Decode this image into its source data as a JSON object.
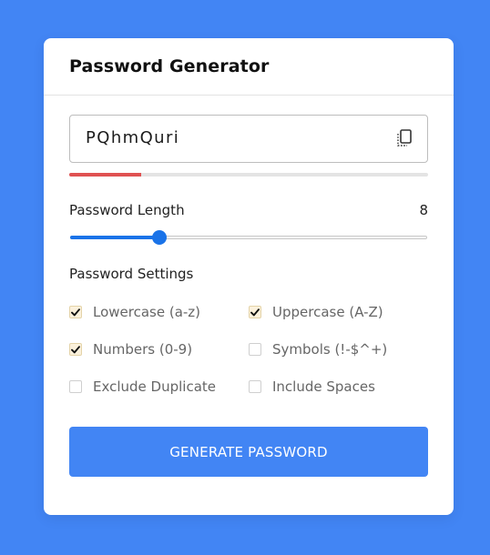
{
  "header": {
    "title": "Password Generator"
  },
  "password": {
    "value": "PQhmQuri",
    "copy_icon": "copy-icon",
    "strength_fraction": 0.2,
    "strength_color": "#e05151"
  },
  "length": {
    "label": "Password Length",
    "value": "8",
    "slider_fraction": 0.25
  },
  "settings": {
    "title": "Password Settings",
    "options": [
      {
        "label": "Lowercase (a-z)",
        "checked": true
      },
      {
        "label": "Uppercase (A-Z)",
        "checked": true
      },
      {
        "label": "Numbers (0-9)",
        "checked": true
      },
      {
        "label": "Symbols (!-$^+)",
        "checked": false
      },
      {
        "label": "Exclude Duplicate",
        "checked": false
      },
      {
        "label": "Include Spaces",
        "checked": false
      }
    ]
  },
  "button": {
    "label": "GENERATE PASSWORD"
  },
  "colors": {
    "background": "#4285f4",
    "accent": "#1a73e8"
  }
}
